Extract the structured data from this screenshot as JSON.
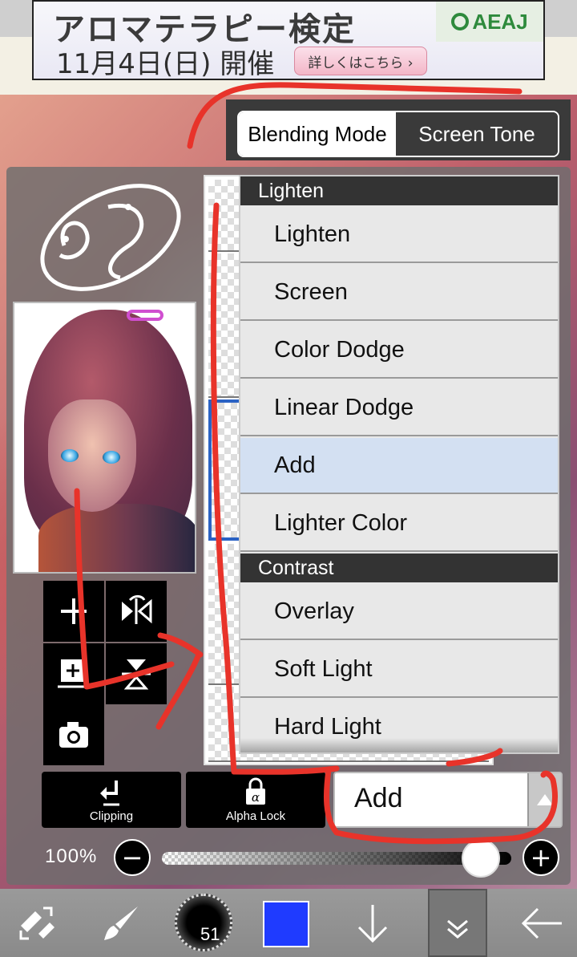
{
  "ad": {
    "title": "アロマテラピー検定",
    "date_text": "11月4日(日) 開催",
    "cta_label": "詳しくはこちら ›",
    "brand": "AEAJ"
  },
  "mode_tabs": {
    "blending_mode_label": "Blending Mode",
    "screen_tone_label": "Screen Tone"
  },
  "blend_list": {
    "headers": [
      "Lighten",
      "Contrast"
    ],
    "items": [
      "Lighten",
      "Screen",
      "Color Dodge",
      "Linear Dodge",
      "Add",
      "Lighter Color",
      "Overlay",
      "Soft Light",
      "Hard Light"
    ],
    "selected": "Add"
  },
  "actions": {
    "clipping_label": "Clipping",
    "alpha_lock_label": "Alpha Lock"
  },
  "blend_select": {
    "value": "Add"
  },
  "opacity": {
    "label": "100%",
    "value_percent": 100
  },
  "bottom_bar": {
    "brush_size": "51",
    "color": "#1f3bff"
  },
  "icons": [
    "plus-icon",
    "flip-horizontal-icon",
    "add-layer-icon",
    "flip-vertical-icon",
    "camera-icon",
    "clipping-icon",
    "alpha-lock-icon",
    "minus-icon",
    "transform-icon",
    "brush-icon",
    "arrow-down-icon",
    "layer-menu-icon",
    "back-arrow-icon"
  ]
}
